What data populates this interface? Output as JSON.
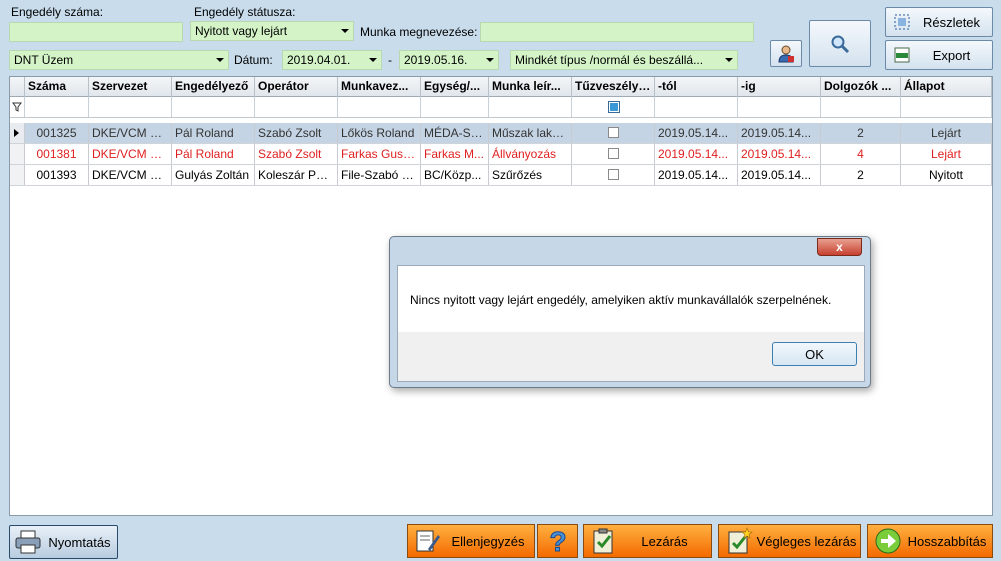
{
  "filters": {
    "permit_number_label": "Engedély száma:",
    "permit_number_value": "",
    "permit_status_label": "Engedély státusza:",
    "permit_status_value": "Nyitott vagy lejárt",
    "work_name_label": "Munka megnevezése:",
    "work_name_value": "",
    "plant_value": "DNT Üzem",
    "date_label": "Dátum:",
    "date_from": "2019.04.01.",
    "date_separator": "-",
    "date_to": "2019.05.16.",
    "type_value": "Mindkét típus /normál és beszállá..."
  },
  "buttons": {
    "details": "Részletek",
    "export": "Export",
    "print": "Nyomtatás",
    "countersign": "Ellenjegyzés",
    "close": "Lezárás",
    "final_close": "Végleges lezárás",
    "extend": "Hosszabbítás"
  },
  "grid": {
    "columns": [
      "Száma",
      "Szervezet",
      "Engedélyező",
      "Operátor",
      "Munkavez...",
      "Egység/...",
      "Munka leír...",
      "Tűzveszélyes",
      "-tól",
      "-ig",
      "Dolgozók ...",
      "Állapot"
    ],
    "rows": [
      {
        "number": "001325",
        "org": "DKE/VCM Ü...",
        "authorizer": "Pál Roland",
        "operator": "Szabó Zsolt",
        "supervisor": "Lőkös Roland",
        "unit": "MÉDA-ST...",
        "description": "Műszak laka...",
        "from": "2019.05.14...",
        "to": "2019.05.14...",
        "workers": "2",
        "status": "Lejárt"
      },
      {
        "number": "001381",
        "org": "DKE/VCM Ü...",
        "authorizer": "Pál Roland",
        "operator": "Szabó Zsolt",
        "supervisor": "Farkas Gusz...",
        "unit": "Farkas M...",
        "description": "Állványozás",
        "from": "2019.05.14...",
        "to": "2019.05.14...",
        "workers": "4",
        "status": "Lejárt"
      },
      {
        "number": "001393",
        "org": "DKE/VCM Ü...",
        "authorizer": "Gulyás Zoltán",
        "operator": "Koleszár Péter",
        "supervisor": "File-Szabó S...",
        "unit": "BC/Közp...",
        "description": "Szűrőzés",
        "from": "2019.05.14...",
        "to": "2019.05.14...",
        "workers": "2",
        "status": "Nyitott"
      }
    ]
  },
  "dialog": {
    "close_glyph": "x",
    "message": "Nincs nyitott vagy lejárt engedély, amelyiken aktív munkavállalók szerpelnének.",
    "ok": "OK"
  },
  "colors": {
    "background": "#c8dcec",
    "field_green": "#d4f4c8",
    "selected_row": "#c4d4e4",
    "expired_red": "#e02020",
    "orange_button": "#f46a00"
  }
}
